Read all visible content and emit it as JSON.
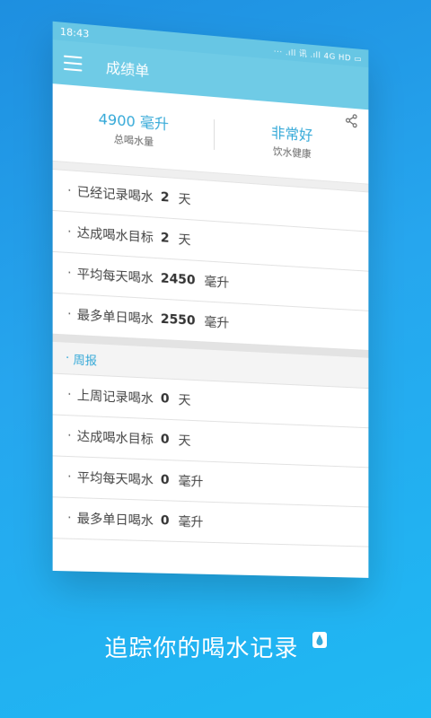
{
  "status_bar": {
    "time": "18:43",
    "right": "··· .ıll 讯 .ıll 4G HD ▭"
  },
  "toolbar": {
    "title": "成绩单"
  },
  "summary": {
    "total_value": "4900 毫升",
    "total_label": "总喝水量",
    "health_value": "非常好",
    "health_label": "饮水健康"
  },
  "stats": [
    {
      "label": "已经记录喝水",
      "value": "2",
      "unit": "天"
    },
    {
      "label": "达成喝水目标",
      "value": "2",
      "unit": "天"
    },
    {
      "label": "平均每天喝水",
      "value": "2450",
      "unit": "毫升"
    },
    {
      "label": "最多单日喝水",
      "value": "2550",
      "unit": "毫升"
    }
  ],
  "weekly": {
    "title": "周报",
    "items": [
      {
        "label": "上周记录喝水",
        "value": "0",
        "unit": "天"
      },
      {
        "label": "达成喝水目标",
        "value": "0",
        "unit": "天"
      },
      {
        "label": "平均每天喝水",
        "value": "0",
        "unit": "毫升"
      },
      {
        "label": "最多单日喝水",
        "value": "0",
        "unit": "毫升"
      }
    ]
  },
  "caption": "追踪你的喝水记录",
  "colors": {
    "accent": "#35a9d8",
    "toolbar": "#6fcbe6",
    "background": "#26a6ee"
  }
}
